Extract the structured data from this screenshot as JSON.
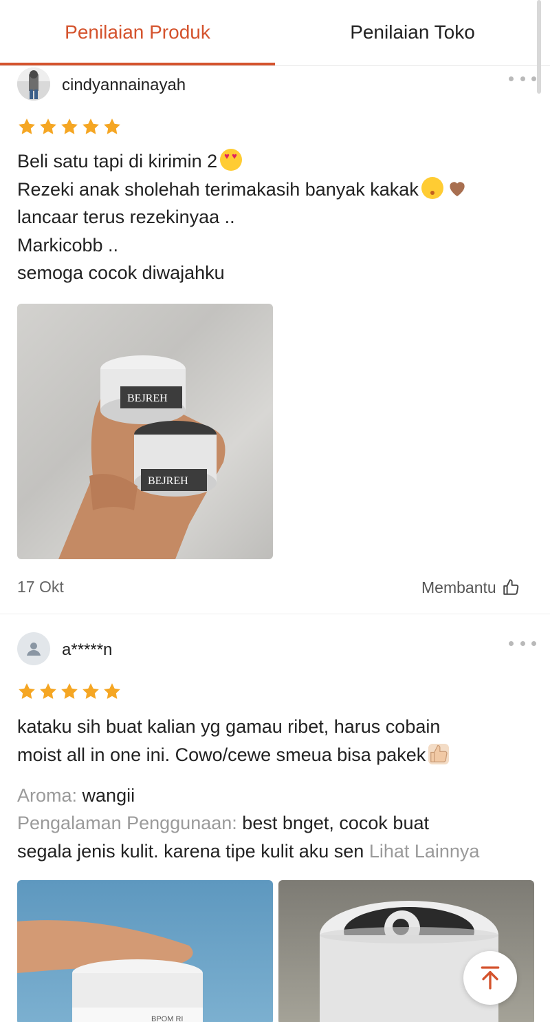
{
  "tabs": {
    "product_label": "Penilaian Produk",
    "store_label": "Penilaian Toko"
  },
  "reviews": [
    {
      "username": "cindyannainayah",
      "rating": 5,
      "lines": [
        "Beli satu tapi di kirimin 2",
        "Rezeki anak sholehah terimakasih banyak kakak",
        "lancaar terus rezekinyaa ..",
        "Markicobb ..",
        "semoga cocok diwajahku"
      ],
      "photo_text": {
        "brand_top": "BEJREH",
        "brand_bottom": "BEJREH"
      },
      "date": "17 Okt",
      "helpful_label": "Membantu"
    },
    {
      "username": "a*****n",
      "rating": 5,
      "lines": [
        "kataku sih buat kalian yg gamau ribet, harus cobain",
        "moist all in one ini. Cowo/cewe smeua bisa pakek"
      ],
      "aroma_label": "Aroma:",
      "aroma_value": "wangii",
      "experience_label": "Pengalaman Penggunaan:",
      "experience_value_1": "best bnget, cocok buat",
      "experience_value_2": "segala jenis kulit. karena tipe kulit aku sen",
      "see_more": "Lihat Lainnya",
      "photo_text": "BPOM RI"
    }
  ],
  "colors": {
    "accent": "#d4532d",
    "star": "#f5a623"
  }
}
